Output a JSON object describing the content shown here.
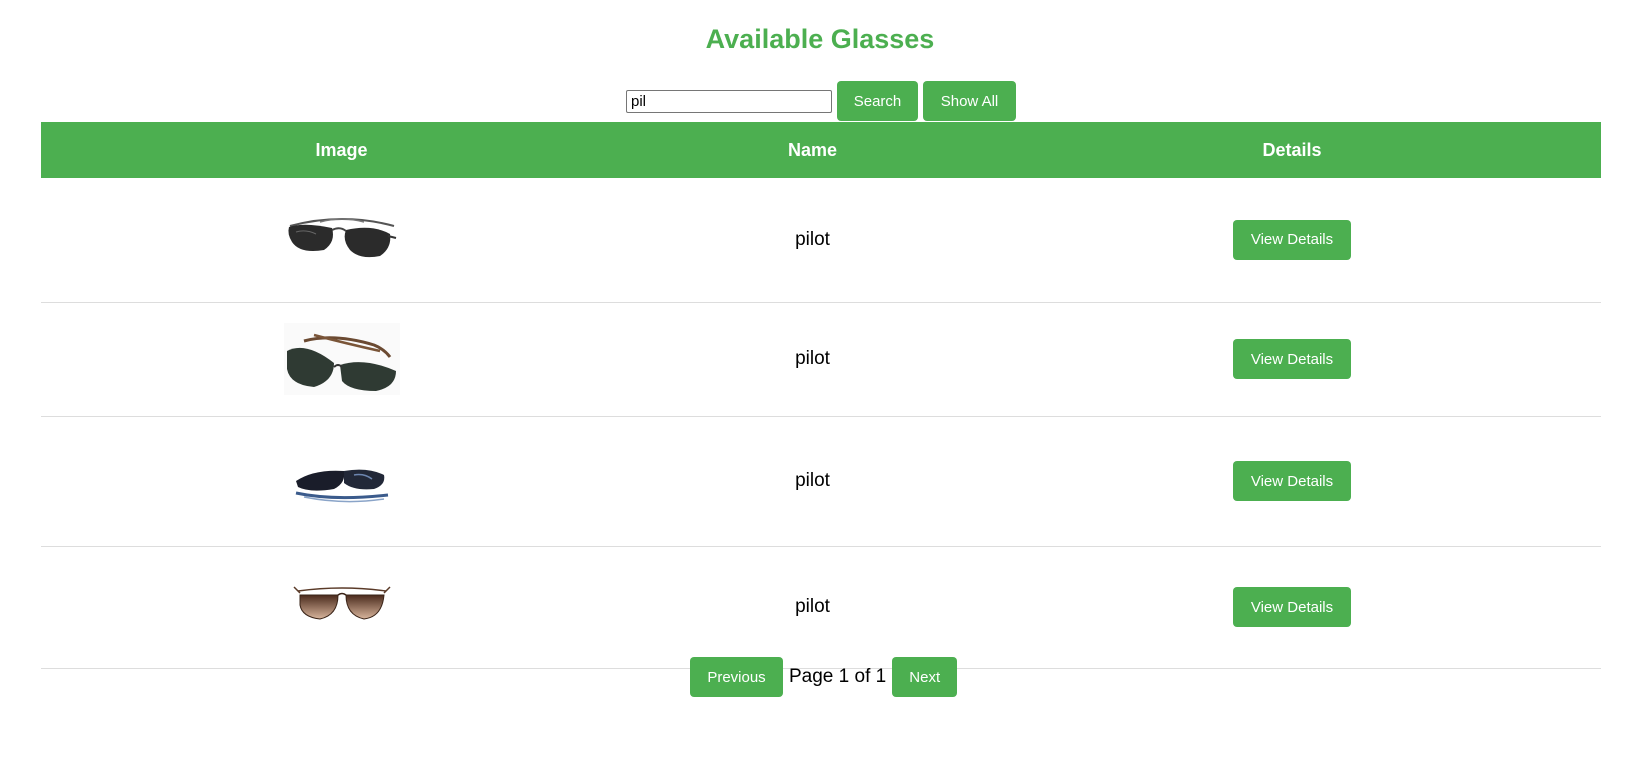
{
  "title": "Available Glasses",
  "search": {
    "value": "pil",
    "button": "Search",
    "show_all": "Show All"
  },
  "table": {
    "headers": [
      "Image",
      "Name",
      "Details"
    ],
    "rows": [
      {
        "image": "aviator-sunglasses-dark",
        "name": "pilot",
        "action": "View Details"
      },
      {
        "image": "aviator-sunglasses-folded",
        "name": "pilot",
        "action": "View Details"
      },
      {
        "image": "sport-sunglasses-blue",
        "name": "pilot",
        "action": "View Details"
      },
      {
        "image": "aviator-sunglasses-brown-gradient",
        "name": "pilot",
        "action": "View Details"
      }
    ]
  },
  "pagination": {
    "previous": "Previous",
    "info": "Page 1 of 1",
    "next": "Next"
  },
  "colors": {
    "accent": "#4caf50",
    "row_divider": "#dddddd"
  }
}
